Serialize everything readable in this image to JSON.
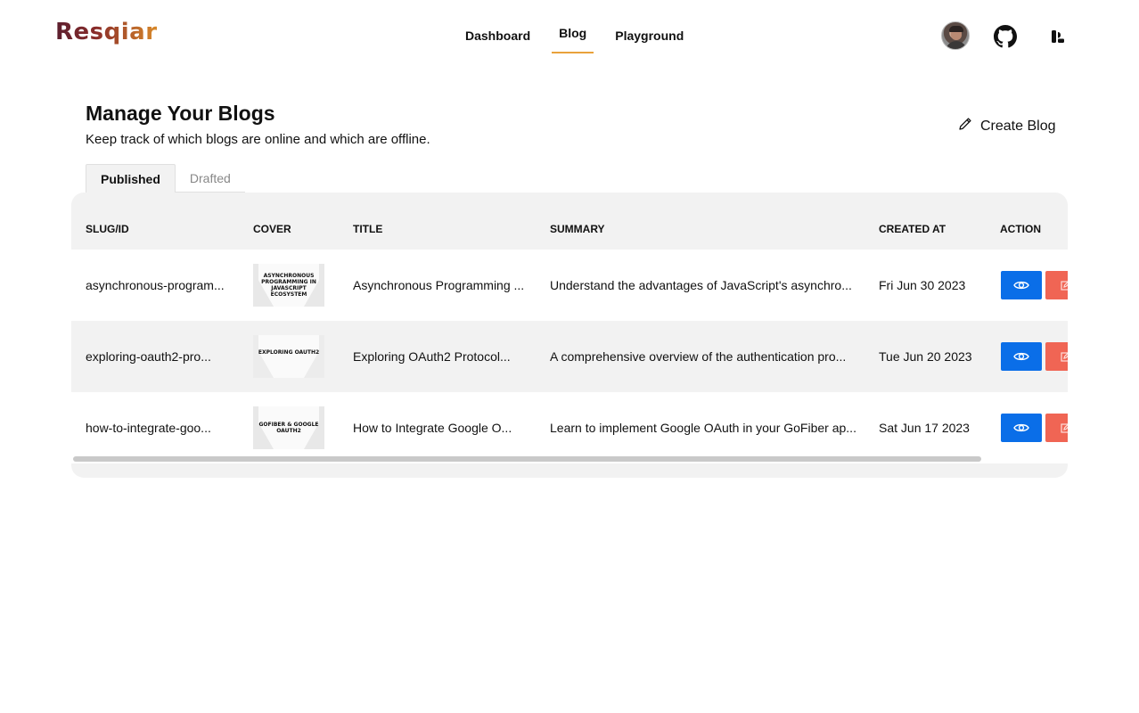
{
  "header": {
    "logo": "Resqiar",
    "nav": [
      {
        "label": "Dashboard",
        "active": false
      },
      {
        "label": "Blog",
        "active": true
      },
      {
        "label": "Playground",
        "active": false
      }
    ],
    "icons": [
      "avatar",
      "github-icon",
      "dev-logo-icon"
    ],
    "accent_color": "#e9a23b"
  },
  "page": {
    "title": "Manage Your Blogs",
    "subtitle": "Keep track of which blogs are online and which are offline.",
    "create_label": "Create Blog"
  },
  "tabs": [
    {
      "label": "Published",
      "active": true
    },
    {
      "label": "Drafted",
      "active": false
    }
  ],
  "table": {
    "columns": [
      "SLUG/ID",
      "COVER",
      "TITLE",
      "SUMMARY",
      "CREATED AT",
      "ACTION"
    ],
    "rows": [
      {
        "slug": "asynchronous-program...",
        "cover_text": "ASYNCHRONOUS PROGRAMMING IN JAVASCRIPT ECOSYSTEM",
        "title": "Asynchronous Programming ...",
        "summary": "Understand the advantages of JavaScript's asynchro...",
        "created_at": "Fri Jun 30 2023"
      },
      {
        "slug": "exploring-oauth2-pro...",
        "cover_text": "EXPLORING OAUTH2",
        "title": "Exploring OAuth2 Protocol...",
        "summary": "A comprehensive overview of the authentication pro...",
        "created_at": "Tue Jun 20 2023"
      },
      {
        "slug": "how-to-integrate-goo...",
        "cover_text": "GOFIBER & GOOGLE OAUTH2",
        "title": "How to Integrate Google O...",
        "summary": "Learn to implement Google OAuth in your GoFiber ap...",
        "created_at": "Sat Jun 17 2023"
      }
    ],
    "action_colors": {
      "view": "#0a6ee8",
      "edit": "#f06554"
    }
  }
}
